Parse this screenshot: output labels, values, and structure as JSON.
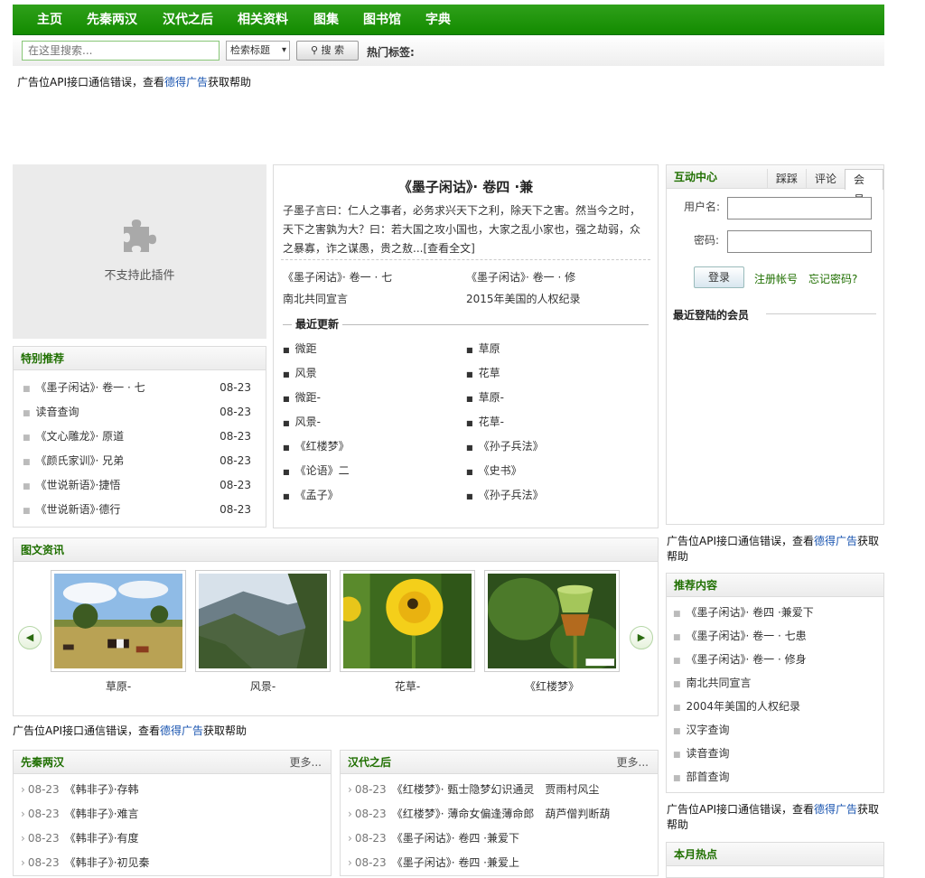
{
  "nav": {
    "items": [
      "主页",
      "先秦两汉",
      "汉代之后",
      "相关资料",
      "图集",
      "图书馆",
      "字典"
    ]
  },
  "search": {
    "placeholder": "在这里搜索...",
    "select_value": "检索标题",
    "button_label": "搜 索",
    "hot_label": "热门标签:"
  },
  "ad": {
    "prefix": "广告位API接口通信错误，查看",
    "link": "德得广告",
    "suffix": "获取帮助"
  },
  "plugin": {
    "text": "不支持此插件"
  },
  "featured": {
    "title": "特别推荐",
    "items": [
      {
        "title": "《墨子闲诂》· 卷一 · 七",
        "date": "08-23"
      },
      {
        "title": "读音查询",
        "date": "08-23"
      },
      {
        "title": "《文心雕龙》· 原道",
        "date": "08-23"
      },
      {
        "title": "《颜氏家训》· 兄弟",
        "date": "08-23"
      },
      {
        "title": "《世说新语》·捷悟",
        "date": "08-23"
      },
      {
        "title": "《世说新语》·德行",
        "date": "08-23"
      }
    ]
  },
  "article": {
    "title": "《墨子闲诂》· 卷四 ·兼",
    "summary_line1": "子墨子言曰：仁人之事者，必务求兴天下之利，除天下之害。然当今之时，",
    "summary_line2": "天下之害孰为大？曰：若大国之攻小国也，大家之乱小家也，强之劫弱，众",
    "summary_line3": "之暴寡，诈之谋愚，贵之敖...[查看全文]",
    "links": [
      "《墨子闲诂》· 卷一 · 七",
      "《墨子闲诂》· 卷一 · 修",
      "南北共同宣言",
      "2015年美国的人权纪录"
    ],
    "recent_label": "最近更新",
    "recent": [
      "微距",
      "草原",
      "风景",
      "花草",
      "微距-",
      "草原-",
      "风景-",
      "花草-",
      "《红楼梦》",
      "《孙子兵法》",
      "《论语》二",
      "《史书》",
      "《孟子》",
      "《孙子兵法》"
    ]
  },
  "member": {
    "header": "互动中心",
    "tabs": [
      "踩踩",
      "评论",
      "会员"
    ],
    "username_label": "用户名:",
    "password_label": "密码:",
    "login_label": "登录",
    "register_label": "注册帐号",
    "forgot_label": "忘记密码?",
    "recent_login_label": "最近登陆的会员"
  },
  "gallery": {
    "title": "图文资讯",
    "captions": [
      "草原-",
      "风景-",
      "花草-",
      "《红楼梦》"
    ]
  },
  "recommend": {
    "title": "推荐内容",
    "items": [
      "《墨子闲诂》· 卷四 ·兼爱下",
      "《墨子闲诂》· 卷一 · 七患",
      "《墨子闲诂》· 卷一 · 修身",
      "南北共同宣言",
      "2004年美国的人权纪录",
      "汉字查询",
      "读音查询",
      "部首查询"
    ]
  },
  "qin": {
    "title": "先秦两汉",
    "more": "更多...",
    "items": [
      {
        "date": "08-23",
        "title": "《韩非子》·存韩"
      },
      {
        "date": "08-23",
        "title": "《韩非子》·难言"
      },
      {
        "date": "08-23",
        "title": "《韩非子》·有度"
      },
      {
        "date": "08-23",
        "title": "《韩非子》·初见秦"
      }
    ]
  },
  "han": {
    "title": "汉代之后",
    "more": "更多...",
    "items": [
      {
        "date": "08-23",
        "title": "《红楼梦》· 甄士隐梦幻识通灵　贾雨村风尘"
      },
      {
        "date": "08-23",
        "title": "《红楼梦》· 薄命女偏逢薄命郎　葫芦僧判断葫"
      },
      {
        "date": "08-23",
        "title": "《墨子闲诂》· 卷四 ·兼爱下"
      },
      {
        "date": "08-23",
        "title": "《墨子闲诂》· 卷四 ·兼爱上"
      }
    ]
  },
  "hot": {
    "title": "本月热点"
  }
}
